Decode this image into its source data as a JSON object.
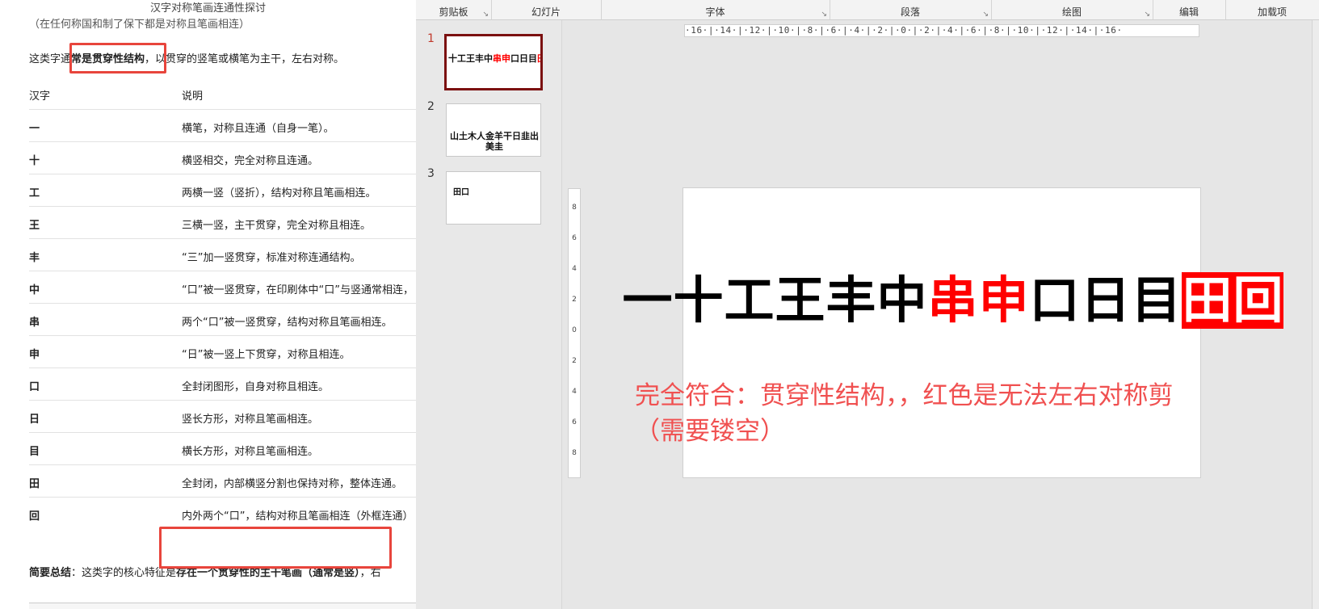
{
  "doc": {
    "title": "汉字对称笔画连通性探讨",
    "cut_text": "（在任何称国和制了保下都是对称且笔画相连）",
    "intro": {
      "prefix": "这类字通",
      "highlight": "常是贯穿性结构",
      "suffix": "，以贯穿的竖笔或横笔为主干，左右对称。"
    },
    "table": {
      "headers": [
        "汉字",
        "说明"
      ],
      "rows": [
        {
          "char": "一",
          "desc": "横笔，对称且连通（自身一笔）。"
        },
        {
          "char": "十",
          "desc": "横竖相交，完全对称且连通。"
        },
        {
          "char": "工",
          "desc": "两横一竖（竖折），结构对称且笔画相连。"
        },
        {
          "char": "王",
          "desc": "三横一竖，主干贯穿，完全对称且相连。"
        },
        {
          "char": "丰",
          "desc": "“三”加一竖贯穿，标准对称连通结构。"
        },
        {
          "char": "中",
          "desc": "“口”被一竖贯穿，在印刷体中“口”与竖通常相连，"
        },
        {
          "char": "串",
          "desc": "两个“口”被一竖贯穿，结构对称且笔画相连。"
        },
        {
          "char": "申",
          "desc": "“日”被一竖上下贯穿，对称且相连。"
        },
        {
          "char": "口",
          "desc": "全封闭图形，自身对称且相连。"
        },
        {
          "char": "日",
          "desc": "竖长方形，对称且笔画相连。"
        },
        {
          "char": "目",
          "desc": "横长方形，对称且笔画相连。"
        },
        {
          "char": "田",
          "desc": "全封闭，内部横竖分割也保持对称，整体连通。"
        },
        {
          "char": "回",
          "desc": "内外两个“口”，结构对称且笔画相连（外框连通）"
        }
      ]
    },
    "summary": {
      "label": "简要总结",
      "text1": "：这类字的核心特",
      "text2": "征是",
      "bold": "存在一个贯穿性的主干笔画（通常是竖）",
      "tail": "，右"
    }
  },
  "ppt": {
    "ribbon": [
      {
        "label": "剪贴板",
        "launcher": true
      },
      {
        "label": "幻灯片",
        "launcher": false
      },
      {
        "label": "字体",
        "launcher": true
      },
      {
        "label": "段落",
        "launcher": true
      },
      {
        "label": "绘图",
        "launcher": true
      },
      {
        "label": "编辑",
        "launcher": false
      },
      {
        "label": "加载项",
        "launcher": false
      }
    ],
    "launcher_glyph": "↘",
    "thumbnails": [
      {
        "num": "1",
        "text": "十工王丰中串申口日目"
      },
      {
        "num": "2",
        "text_line1": "山土木人金羊干日韭出",
        "text_line2": "美圭"
      },
      {
        "num": "3",
        "text": "田口"
      }
    ],
    "hruler_text": "·16·|·14·|·12·|·10·|·8·|·6·|·4·|·2·|·0·|·2·|·4·|·6·|·8·|·10·|·12·|·14·|·16·",
    "vruler_ticks": [
      "8",
      "6",
      "4",
      "2",
      "0",
      "2",
      "4",
      "6",
      "8"
    ],
    "slide": {
      "chars": [
        {
          "c": "一",
          "style": "black"
        },
        {
          "c": "十",
          "style": "black"
        },
        {
          "c": "工",
          "style": "black"
        },
        {
          "c": "王",
          "style": "black"
        },
        {
          "c": "丰",
          "style": "black"
        },
        {
          "c": "中",
          "style": "black"
        },
        {
          "c": "串",
          "style": "red"
        },
        {
          "c": "申",
          "style": "red"
        },
        {
          "c": "口",
          "style": "black"
        },
        {
          "c": "日",
          "style": "black"
        },
        {
          "c": "目",
          "style": "black"
        },
        {
          "c": "田",
          "style": "redbox"
        },
        {
          "c": "回",
          "style": "redbox"
        }
      ],
      "note": "完全符合：贯穿性结构，，红色是无法左右对称剪（需要镂空）"
    },
    "colors": {
      "red": "#ff0000",
      "note": "#f05050",
      "highlight_box": "#e8453c"
    }
  }
}
